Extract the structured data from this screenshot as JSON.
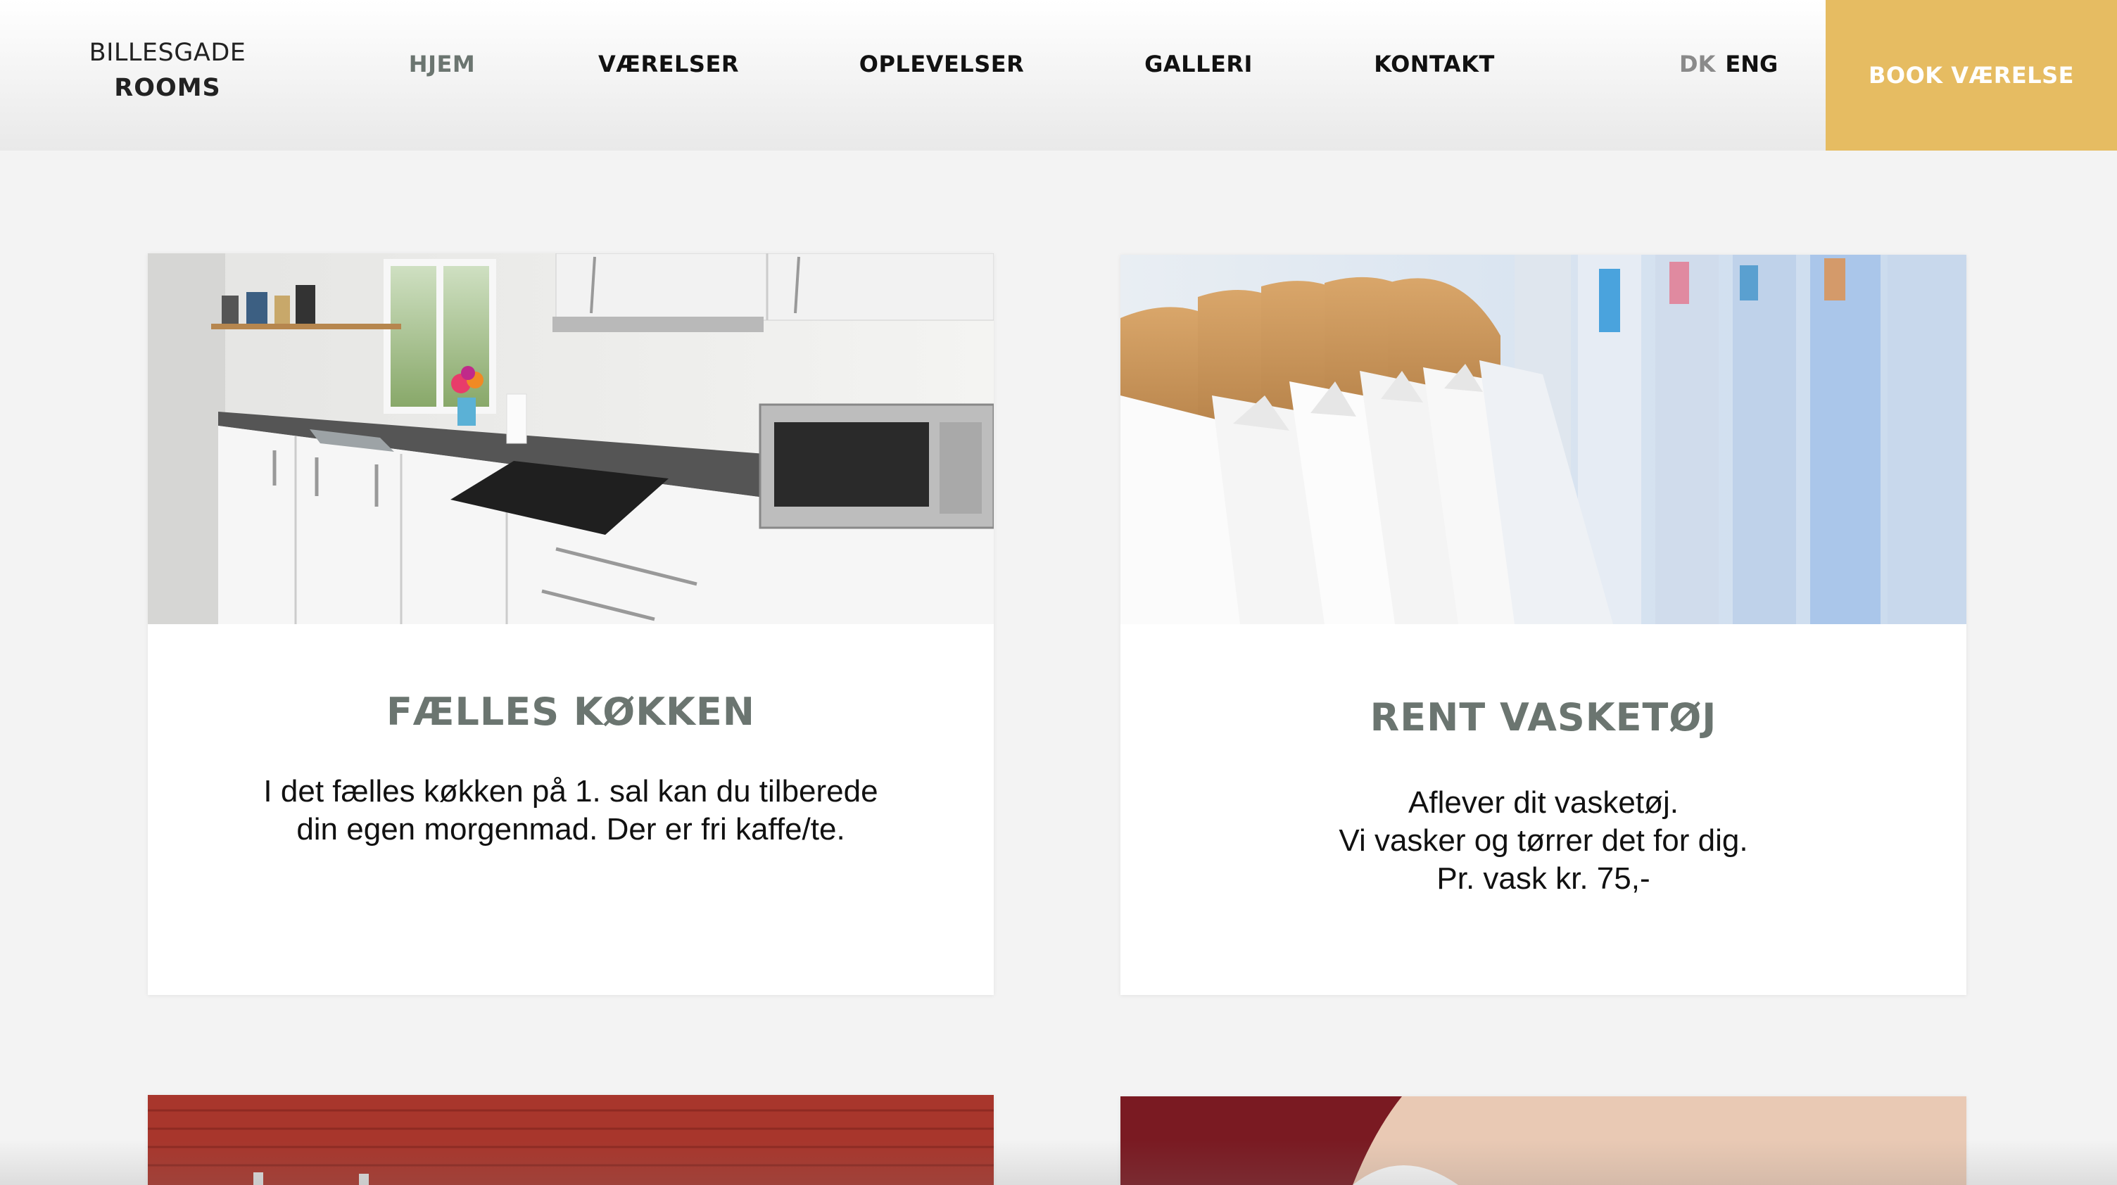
{
  "brand": {
    "line1": "BILLESGADE",
    "line2": "ROOMS"
  },
  "nav": {
    "items": [
      "HJEM",
      "VÆRELSER",
      "OPLEVELSER",
      "GALLERI",
      "KONTAKT"
    ],
    "active_index": 0
  },
  "language": {
    "dk": "DK",
    "eng": "ENG"
  },
  "book_button": {
    "label": "BOOK VÆRELSE"
  },
  "cards": [
    {
      "title": "FÆLLES KØKKEN",
      "desc_lines": [
        "I det fælles køkken på 1. sal kan du tilberede",
        "din egen morgenmad. Der er fri kaffe/te."
      ]
    },
    {
      "title": "RENT VASKETØJ",
      "desc_lines": [
        "Aflever dit vasketøj.",
        "Vi vasker og tørrer det for dig.",
        "Pr. vask kr. 75,-"
      ]
    }
  ],
  "colors": {
    "accent": "#e6bc62",
    "heading": "#6b7570",
    "background": "#f3f3f3"
  }
}
